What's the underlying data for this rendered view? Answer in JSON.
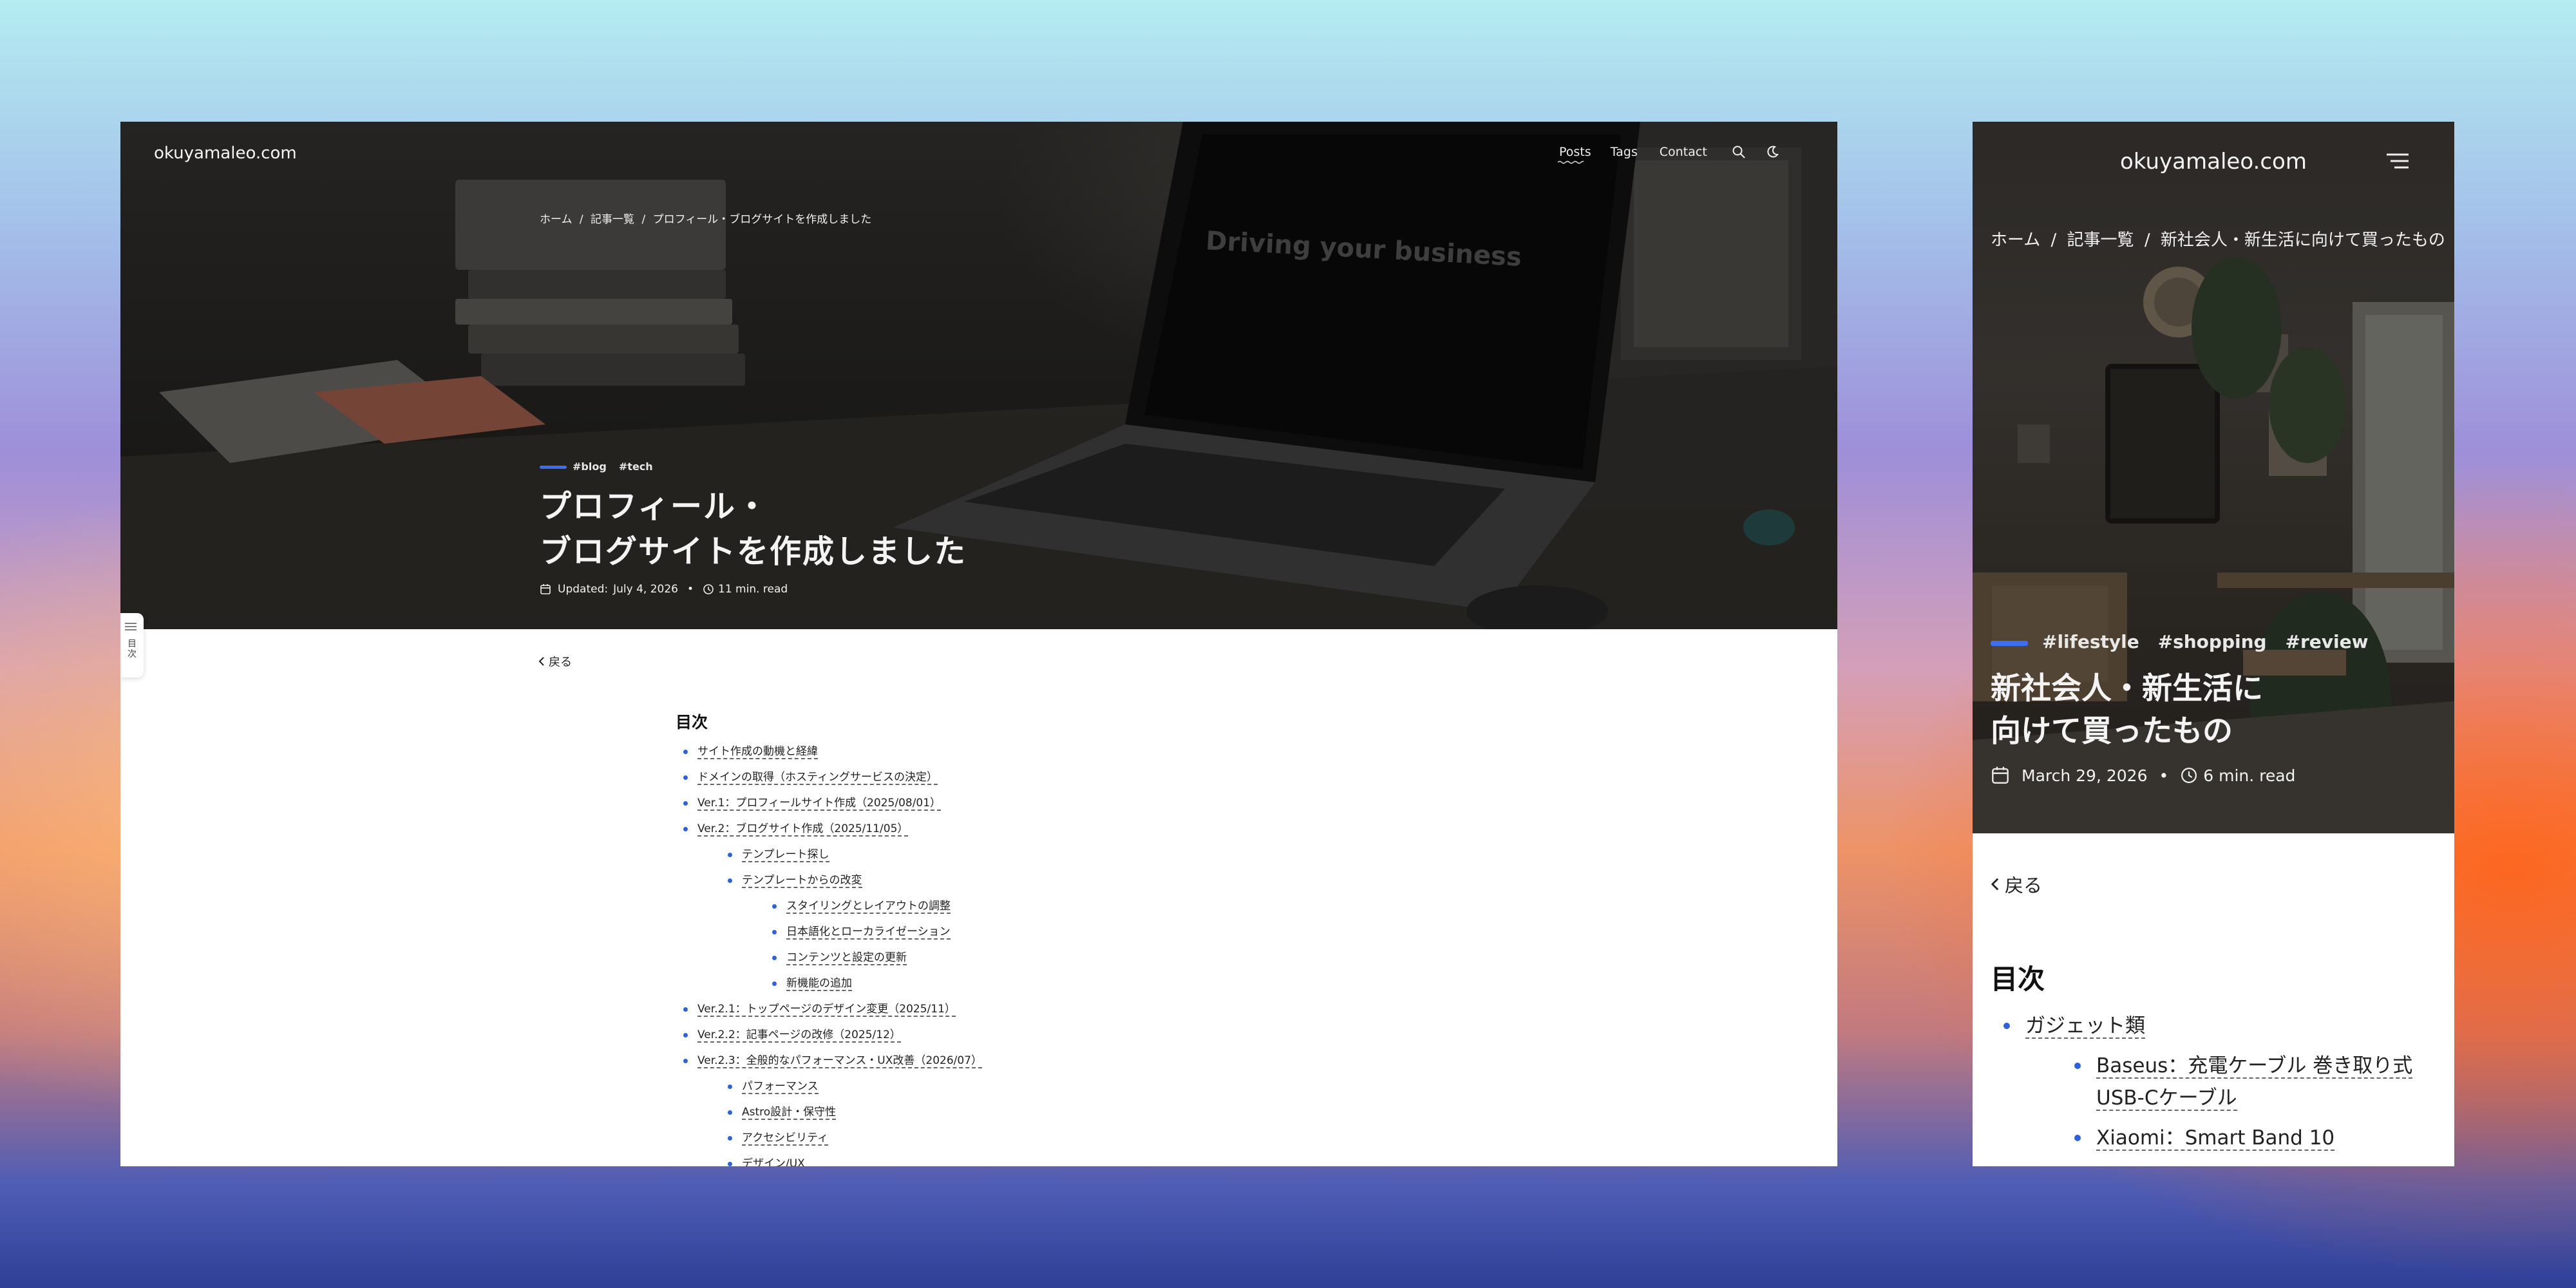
{
  "desktop": {
    "site_title": "okuyamaleo.com",
    "nav": {
      "posts": "Posts",
      "tags": "Tags",
      "contact": "Contact"
    },
    "breadcrumb": {
      "home": "ホーム",
      "sep1": "/",
      "list": "記事一覧",
      "sep2": "/",
      "current": "プロフィール・ブログサイトを作成しました"
    },
    "hero_screen_text": "Driving your business",
    "tags": [
      "#blog",
      "#tech"
    ],
    "title_line1": "プロフィール・",
    "title_line2": "ブログサイトを作成しました",
    "meta": {
      "updated_label": "Updated:",
      "date": "July 4, 2026",
      "dot": "•",
      "read": "11 min. read"
    },
    "sidetab_label": "目次",
    "back_label": "戻る",
    "toc": {
      "title": "目次",
      "items": [
        "サイト作成の動機と経緯",
        "ドメインの取得（ホスティングサービスの決定）",
        "Ver.1：プロフィールサイト作成（2025/08/01）",
        "Ver.2：ブログサイト作成（2025/11/05）",
        "Ver.2.1：トップページのデザイン変更（2025/11）",
        "Ver.2.2：記事ページの改修（2025/12）",
        "Ver.2.3：全般的なパフォーマンス・UX改善（2026/07）"
      ],
      "ver2_children": [
        "テンプレート探し",
        "テンプレートからの改変"
      ],
      "kaihen_children": [
        "スタイリングとレイアウトの調整",
        "日本語化とローカライゼーション",
        "コンテンツと設定の更新",
        "新機能の追加"
      ],
      "ver23_children": [
        "パフォーマンス",
        "Astro設計・保守性",
        "アクセシビリティ",
        "デザイン/UX"
      ]
    }
  },
  "mobile": {
    "site_title": "okuyamaleo.com",
    "breadcrumb": {
      "home": "ホーム",
      "sep1": "/",
      "list": "記事一覧",
      "sep2": "/",
      "current": "新社会人・新生活に向けて買ったもの"
    },
    "tags": [
      "#lifestyle",
      "#shopping",
      "#review"
    ],
    "title_line1": "新社会人・新生活に",
    "title_line2": "向けて買ったもの",
    "meta": {
      "date": "March 29, 2026",
      "dot": "•",
      "read": "6 min. read"
    },
    "back_label": "戻る",
    "toc": {
      "title": "目次",
      "item1": "ガジェット類",
      "sub1": "Baseus：充電ケーブル 巻き取り式 USB-Cケーブル",
      "sub2": "Xiaomi：Smart Band 10"
    }
  },
  "colors": {
    "accent": "#3b6ef0",
    "bullet": "#2f62d8"
  }
}
